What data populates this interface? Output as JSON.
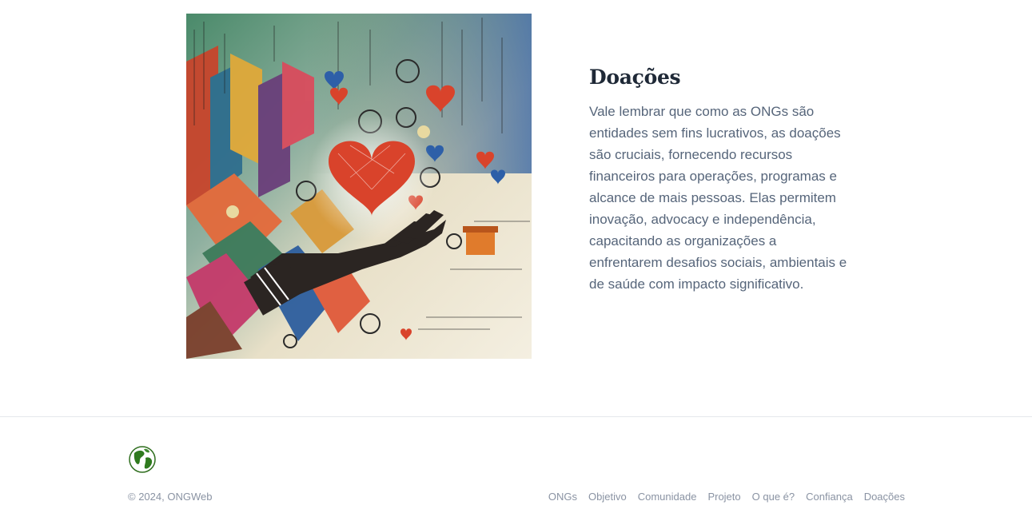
{
  "section": {
    "title": "Doações",
    "body": "Vale lembrar que como as ONGs são entidades sem fins lucrativos, as doações são cruciais, fornecendo recursos financeiros para operações, programas e alcance de mais pessoas. Elas permitem inovação, advocacy e independência, capacitando as organizações a enfrentarem desafios sociais, ambientais e de saúde com impacto significativo.",
    "image_icon": "hand-holding-heart-illustration"
  },
  "footer": {
    "logo_icon": "globe-icon",
    "copyright": "© 2024, ONGWeb",
    "links": [
      "ONGs",
      "Objetivo",
      "Comunidade",
      "Projeto",
      "O que é?",
      "Confiança",
      "Doações"
    ]
  },
  "colors": {
    "heading": "#1f2937",
    "body_text": "#56657a",
    "footer_text": "#8a93a3",
    "heart": "#d9432b"
  }
}
